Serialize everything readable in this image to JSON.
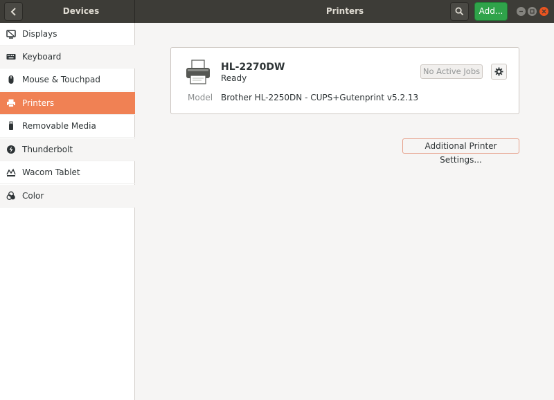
{
  "header": {
    "left_title": "Devices",
    "main_title": "Printers",
    "add_label": "Add..."
  },
  "sidebar": {
    "items": [
      {
        "label": "Displays",
        "icon": "display-icon"
      },
      {
        "label": "Keyboard",
        "icon": "keyboard-icon"
      },
      {
        "label": "Mouse & Touchpad",
        "icon": "mouse-icon"
      },
      {
        "label": "Printers",
        "icon": "printer-icon",
        "selected": true
      },
      {
        "label": "Removable Media",
        "icon": "usb-drive-icon"
      },
      {
        "label": "Thunderbolt",
        "icon": "thunderbolt-icon"
      },
      {
        "label": "Wacom Tablet",
        "icon": "tablet-icon"
      },
      {
        "label": "Color",
        "icon": "color-icon"
      }
    ]
  },
  "printer": {
    "name": "HL-2270DW",
    "status": "Ready",
    "jobs_label": "No Active Jobs",
    "model_label": "Model",
    "model_value": "Brother HL-2250DN - CUPS+Gutenprint v5.2.13"
  },
  "additional_settings_label": "Additional Printer Settings...",
  "colors": {
    "accent": "#f08154",
    "add_button": "#2fa34a",
    "close_button": "#e95420",
    "headerbar": "#3d3c37"
  }
}
